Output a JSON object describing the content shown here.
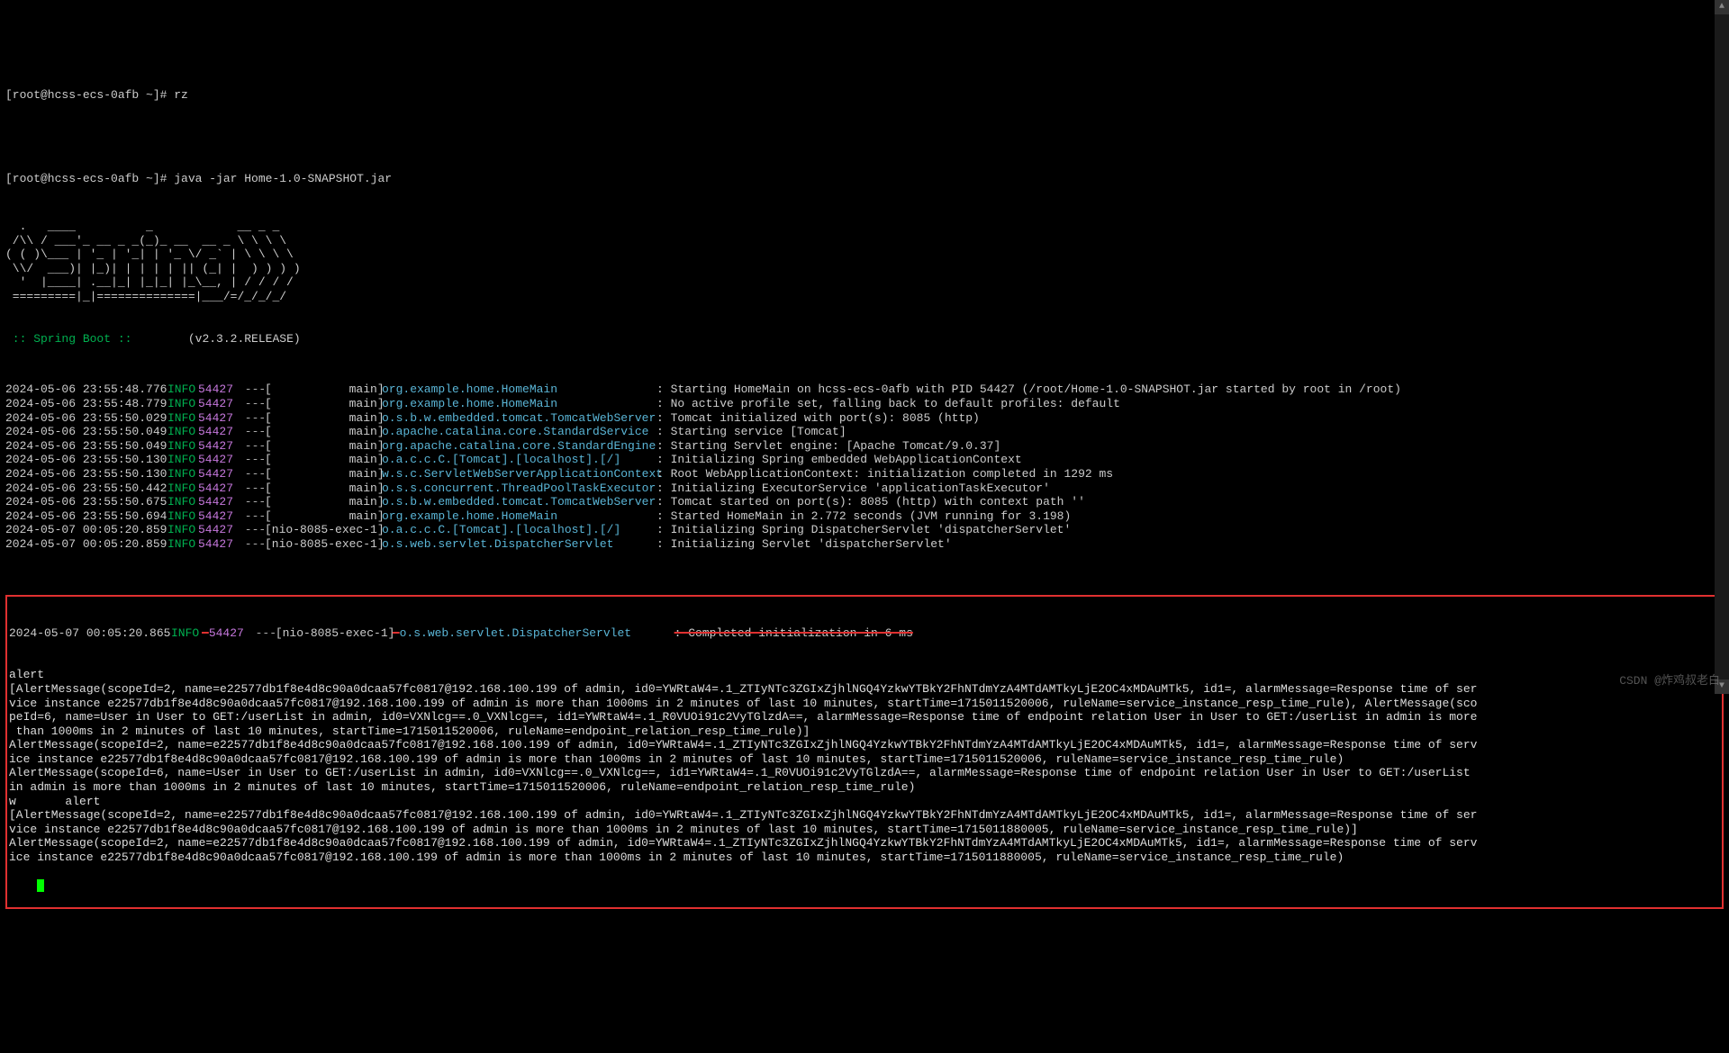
{
  "prompt1": "[root@hcss-ecs-0afb ~]# rz",
  "prompt2": "[root@hcss-ecs-0afb ~]# java -jar Home-1.0-SNAPSHOT.jar",
  "ascii": "  .   ____          _            __ _ _\n /\\\\ / ___'_ __ _ _(_)_ __  __ _ \\ \\ \\ \\\n( ( )\\___ | '_ | '_| | '_ \\/ _` | \\ \\ \\ \\\n \\\\/  ___)| |_)| | | | | || (_| |  ) ) ) )\n  '  |____| .__|_| |_|_| |_\\__, | / / / /\n =========|_|==============|___/=/_/_/_/",
  "spring_boot_label": " :: Spring Boot ::",
  "spring_version": "        (v2.3.2.RELEASE)",
  "logs": [
    {
      "ts": "2024-05-06 23:55:48.776",
      "lvl": "INFO",
      "pid": "54427",
      "th": "[           main]",
      "lg": "org.example.home.HomeMain",
      "msg": ": Starting HomeMain on hcss-ecs-0afb with PID 54427 (/root/Home-1.0-SNAPSHOT.jar started by root in /root)"
    },
    {
      "ts": "2024-05-06 23:55:48.779",
      "lvl": "INFO",
      "pid": "54427",
      "th": "[           main]",
      "lg": "org.example.home.HomeMain",
      "msg": ": No active profile set, falling back to default profiles: default"
    },
    {
      "ts": "2024-05-06 23:55:50.029",
      "lvl": "INFO",
      "pid": "54427",
      "th": "[           main]",
      "lg": "o.s.b.w.embedded.tomcat.TomcatWebServer",
      "msg": ": Tomcat initialized with port(s): 8085 (http)"
    },
    {
      "ts": "2024-05-06 23:55:50.049",
      "lvl": "INFO",
      "pid": "54427",
      "th": "[           main]",
      "lg": "o.apache.catalina.core.StandardService",
      "msg": ": Starting service [Tomcat]"
    },
    {
      "ts": "2024-05-06 23:55:50.049",
      "lvl": "INFO",
      "pid": "54427",
      "th": "[           main]",
      "lg": "org.apache.catalina.core.StandardEngine",
      "msg": ": Starting Servlet engine: [Apache Tomcat/9.0.37]"
    },
    {
      "ts": "2024-05-06 23:55:50.130",
      "lvl": "INFO",
      "pid": "54427",
      "th": "[           main]",
      "lg": "o.a.c.c.C.[Tomcat].[localhost].[/]",
      "msg": ": Initializing Spring embedded WebApplicationContext"
    },
    {
      "ts": "2024-05-06 23:55:50.130",
      "lvl": "INFO",
      "pid": "54427",
      "th": "[           main]",
      "lg": "w.s.c.ServletWebServerApplicationContext",
      "msg": ": Root WebApplicationContext: initialization completed in 1292 ms"
    },
    {
      "ts": "2024-05-06 23:55:50.442",
      "lvl": "INFO",
      "pid": "54427",
      "th": "[           main]",
      "lg": "o.s.s.concurrent.ThreadPoolTaskExecutor",
      "msg": ": Initializing ExecutorService 'applicationTaskExecutor'"
    },
    {
      "ts": "2024-05-06 23:55:50.675",
      "lvl": "INFO",
      "pid": "54427",
      "th": "[           main]",
      "lg": "o.s.b.w.embedded.tomcat.TomcatWebServer",
      "msg": ": Tomcat started on port(s): 8085 (http) with context path ''"
    },
    {
      "ts": "2024-05-06 23:55:50.694",
      "lvl": "INFO",
      "pid": "54427",
      "th": "[           main]",
      "lg": "org.example.home.HomeMain",
      "msg": ": Started HomeMain in 2.772 seconds (JVM running for 3.198)"
    },
    {
      "ts": "2024-05-07 00:05:20.859",
      "lvl": "INFO",
      "pid": "54427",
      "th": "[nio-8085-exec-1]",
      "lg": "o.a.c.c.C.[Tomcat].[localhost].[/]",
      "msg": ": Initializing Spring DispatcherServlet 'dispatcherServlet'"
    },
    {
      "ts": "2024-05-07 00:05:20.859",
      "lvl": "INFO",
      "pid": "54427",
      "th": "[nio-8085-exec-1]",
      "lg": "o.s.web.servlet.DispatcherServlet",
      "msg": ": Initializing Servlet 'dispatcherServlet'"
    }
  ],
  "strikelog": {
    "ts": "2024-05-07 00:05:20.865",
    "lvl": "INFO",
    "pid": "54427",
    "th": "[nio-8085-exec-1]",
    "lg": "o.s.web.servlet.DispatcherServlet",
    "msg": ": Completed initialization in 6 ms"
  },
  "alert_lines": [
    "alert",
    "[AlertMessage(scopeId=2, name=e22577db1f8e4d8c90a0dcaa57fc0817@192.168.100.199 of admin, id0=YWRtaW4=.1_ZTIyNTc3ZGIxZjhlNGQ4YzkwYTBkY2FhNTdmYzA4MTdAMTkyLjE2OC4xMDAuMTk5, id1=, alarmMessage=Response time of ser",
    "vice instance e22577db1f8e4d8c90a0dcaa57fc0817@192.168.100.199 of admin is more than 1000ms in 2 minutes of last 10 minutes, startTime=1715011520006, ruleName=service_instance_resp_time_rule), AlertMessage(sco",
    "peId=6, name=User in User to GET:/userList in admin, id0=VXNlcg==.0_VXNlcg==, id1=YWRtaW4=.1_R0VUOi91c2VyTGlzdA==, alarmMessage=Response time of endpoint relation User in User to GET:/userList in admin is more",
    " than 1000ms in 2 minutes of last 10 minutes, startTime=1715011520006, ruleName=endpoint_relation_resp_time_rule)]",
    "AlertMessage(scopeId=2, name=e22577db1f8e4d8c90a0dcaa57fc0817@192.168.100.199 of admin, id0=YWRtaW4=.1_ZTIyNTc3ZGIxZjhlNGQ4YzkwYTBkY2FhNTdmYzA4MTdAMTkyLjE2OC4xMDAuMTk5, id1=, alarmMessage=Response time of serv",
    "ice instance e22577db1f8e4d8c90a0dcaa57fc0817@192.168.100.199 of admin is more than 1000ms in 2 minutes of last 10 minutes, startTime=1715011520006, ruleName=service_instance_resp_time_rule)",
    "AlertMessage(scopeId=6, name=User in User to GET:/userList in admin, id0=VXNlcg==.0_VXNlcg==, id1=YWRtaW4=.1_R0VUOi91c2VyTGlzdA==, alarmMessage=Response time of endpoint relation User in User to GET:/userList",
    "in admin is more than 1000ms in 2 minutes of last 10 minutes, startTime=1715011520006, ruleName=endpoint_relation_resp_time_rule)",
    "w       alert",
    "[AlertMessage(scopeId=2, name=e22577db1f8e4d8c90a0dcaa57fc0817@192.168.100.199 of admin, id0=YWRtaW4=.1_ZTIyNTc3ZGIxZjhlNGQ4YzkwYTBkY2FhNTdmYzA4MTdAMTkyLjE2OC4xMDAuMTk5, id1=, alarmMessage=Response time of ser",
    "vice instance e22577db1f8e4d8c90a0dcaa57fc0817@192.168.100.199 of admin is more than 1000ms in 2 minutes of last 10 minutes, startTime=1715011880005, ruleName=service_instance_resp_time_rule)]",
    "AlertMessage(scopeId=2, name=e22577db1f8e4d8c90a0dcaa57fc0817@192.168.100.199 of admin, id0=YWRtaW4=.1_ZTIyNTc3ZGIxZjhlNGQ4YzkwYTBkY2FhNTdmYzA4MTdAMTkyLjE2OC4xMDAuMTk5, id1=, alarmMessage=Response time of serv",
    "ice instance e22577db1f8e4d8c90a0dcaa57fc0817@192.168.100.199 of admin is more than 1000ms in 2 minutes of last 10 minutes, startTime=1715011880005, ruleName=service_instance_resp_time_rule)"
  ],
  "watermark": "CSDN @炸鸡叔老白",
  "scroll_up": "▲",
  "scroll_down": "▼"
}
